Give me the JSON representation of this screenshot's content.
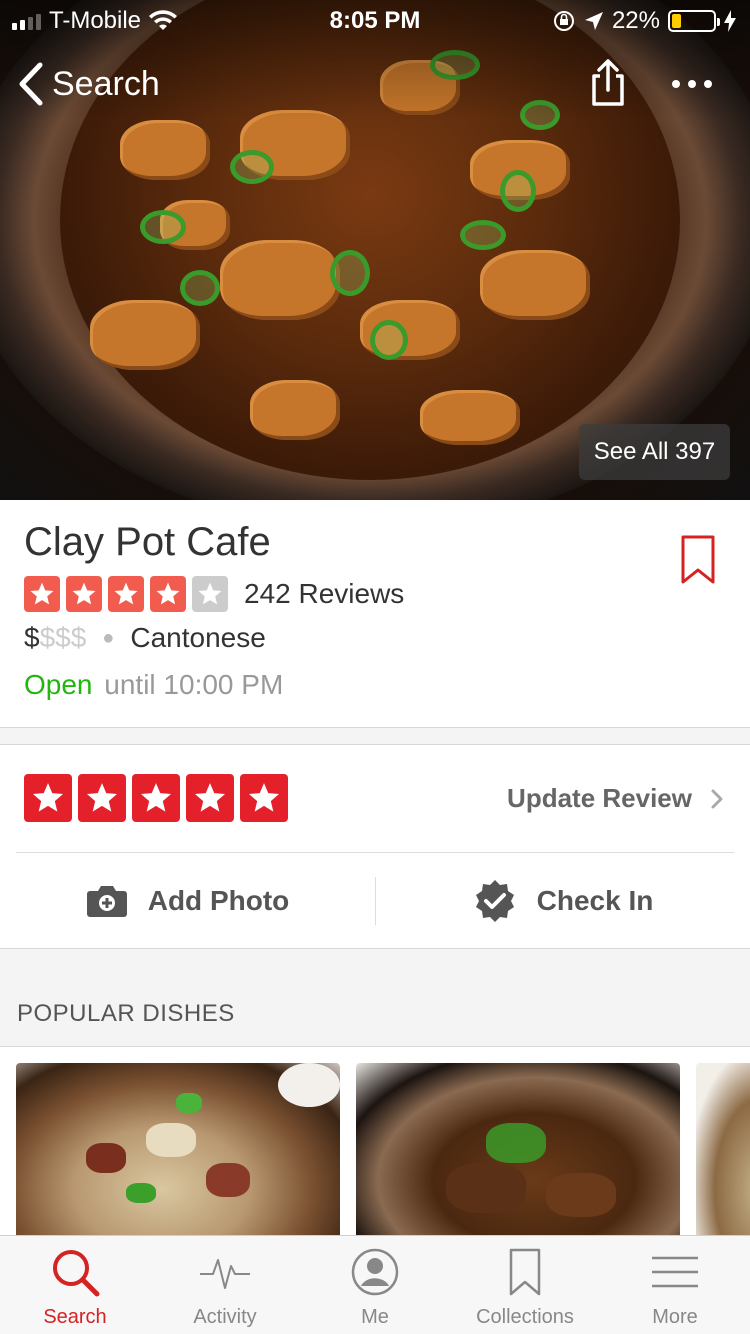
{
  "status_bar": {
    "carrier": "T-Mobile",
    "time": "8:05 PM",
    "battery_percent": "22%",
    "battery_level": 0.22,
    "battery_color": "#ffcc00"
  },
  "nav": {
    "back_label": "Search"
  },
  "hero": {
    "see_all_label": "See All 397"
  },
  "business": {
    "name": "Clay Pot Cafe",
    "rating": 4,
    "rating_max": 5,
    "review_count_label": "242 Reviews",
    "price_active": "$",
    "price_inactive": "$$$",
    "cuisine": "Cantonese",
    "open_label": "Open",
    "hours_label": "until 10:00 PM"
  },
  "my_review": {
    "rating": 5,
    "update_label": "Update Review",
    "add_photo_label": "Add Photo",
    "check_in_label": "Check In"
  },
  "popular_dishes": {
    "heading": "POPULAR DISHES"
  },
  "tabs": [
    {
      "label": "Search",
      "icon": "search-icon",
      "active": true
    },
    {
      "label": "Activity",
      "icon": "activity-icon",
      "active": false
    },
    {
      "label": "Me",
      "icon": "profile-icon",
      "active": false
    },
    {
      "label": "Collections",
      "icon": "bookmark-icon",
      "active": false
    },
    {
      "label": "More",
      "icon": "menu-icon",
      "active": false
    }
  ],
  "colors": {
    "brand_red": "#d32323",
    "star_red": "#e4202b",
    "star_orange_red": "#f15c4f",
    "star_empty": "#cccccc",
    "open_green": "#21b80e"
  }
}
